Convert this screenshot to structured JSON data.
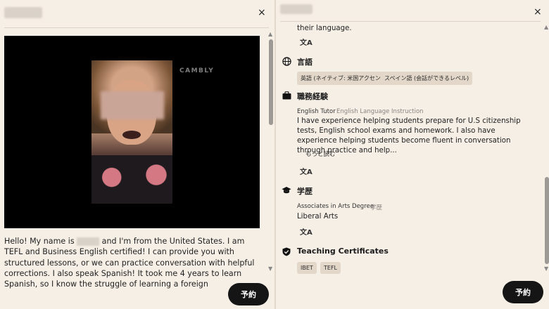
{
  "left_panel": {
    "video": {
      "watermark": "CAMBLY"
    },
    "bio_before": "Hello! My name is ",
    "bio_after": " and I'm from the United States. I am TEFL and Business English certified! I can provide you with structured lessons, or we can practice conversation with helpful corrections. I also speak Spanish! It took me 4 years to learn Spanish, so I know the struggle of learning a foreign",
    "book_label": "予約",
    "close_glyph": "×"
  },
  "right_panel": {
    "close_glyph": "×",
    "top_text": "their language.",
    "translate_glyph": "文A",
    "languages": {
      "title": "言語",
      "chips": [
        "英語 (ネイティブ: 米国アクセント)",
        "スペイン語 (会話ができるレベル)"
      ]
    },
    "experience": {
      "title": "職務経験",
      "role": "English Tutor",
      "field": "English Language Instruction",
      "text": "I have experience helping students prepare for U.S citizenship tests, English school exams and homework. I also have experience helping students become fluent in conversation through practice and help...",
      "read_more": "もっと読む"
    },
    "education": {
      "title": "学歴",
      "degree": "Associates in Arts Degree",
      "degree_tag": "学歴",
      "major": "Liberal Arts"
    },
    "certificates": {
      "title": "Teaching Certificates",
      "chips": [
        "IBET",
        "TEFL"
      ]
    },
    "book_label": "予約"
  },
  "colors": {
    "accent": "#151515",
    "chip": "#e2d7c8",
    "background": "#f6efe6"
  },
  "icons": [
    "close-icon",
    "globe-icon",
    "briefcase-icon",
    "graduation-cap-icon",
    "certificate-badge-icon",
    "translate-icon"
  ]
}
